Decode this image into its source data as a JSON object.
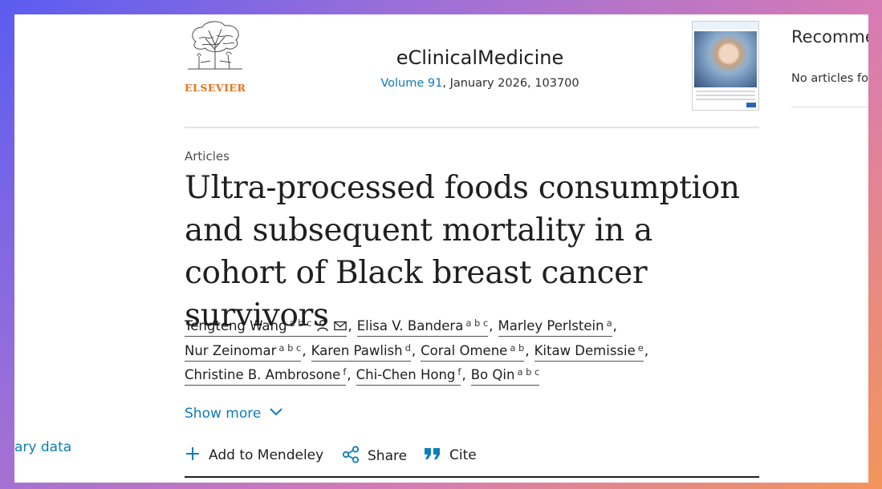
{
  "publisher": {
    "logo_text": "ELSEVIER",
    "logo_icon": "elsevier-tree-icon"
  },
  "journal": {
    "name": "eClinicalMedicine",
    "volume_link": "Volume 91",
    "issue_rest": ", January 2026, 103700",
    "cover_icon": "journal-cover-thumbnail"
  },
  "recommended": {
    "title": "Recommended articles",
    "empty": "No articles found."
  },
  "article": {
    "type": "Articles",
    "title": "Ultra-processed foods consumption and subsequent mortality in a cohort of Black breast cancer survivors"
  },
  "authors": [
    {
      "name": "Tengteng Wang",
      "aff": "a b c"
    },
    {
      "name": "Elisa V. Bandera",
      "aff": "a b c"
    },
    {
      "name": "Marley Perlstein",
      "aff": "a"
    },
    {
      "name": "Nur Zeinomar",
      "aff": "a b c"
    },
    {
      "name": "Karen Pawlish",
      "aff": "d"
    },
    {
      "name": "Coral Omene",
      "aff": "a b"
    },
    {
      "name": "Kitaw Demissie",
      "aff": "e"
    },
    {
      "name": "Christine B. Ambrosone",
      "aff": "f"
    },
    {
      "name": "Chi-Chen Hong",
      "aff": "f"
    },
    {
      "name": "Bo Qin",
      "aff": "a b c"
    }
  ],
  "icons": {
    "person": "person-icon",
    "email": "email-icon",
    "chevron": "chevron-down-icon"
  },
  "show_more": "Show more",
  "sidebar_link": "ary data",
  "actions": {
    "mendeley": "Add to Mendeley",
    "share": "Share",
    "cite": "Cite"
  },
  "colors": {
    "link": "#0c7dbb",
    "elsevier_orange": "#e9711c",
    "text": "#1f1f1f"
  }
}
